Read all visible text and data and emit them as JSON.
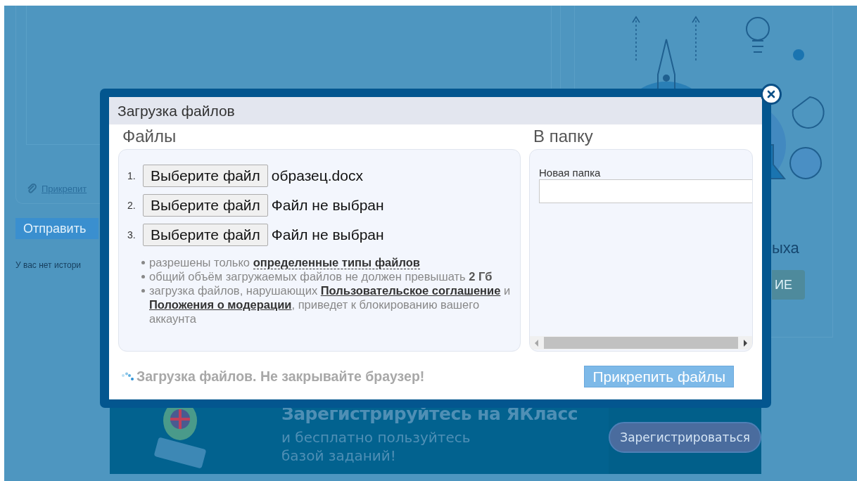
{
  "background_page": {
    "attach_link": "Прикрепит",
    "send_button": "Отправить",
    "history_note": "У вас нет истори",
    "side_text": "ыха",
    "side_button": "ИЕ",
    "banner": {
      "heading": "Зарегистрируйтесь на ЯКласс",
      "subtext": "и бесплатно пользуйтесь\nбазой заданий!",
      "button": "Зарегистрироваться"
    }
  },
  "dialog": {
    "title": "Загрузка файлов",
    "files_heading": "Файлы",
    "folder_heading": "В папку",
    "file_rows": [
      {
        "number": "1.",
        "button": "Выберите файл",
        "file_name": "образец.docx"
      },
      {
        "number": "2.",
        "button": "Выберите файл",
        "file_name": "Файл не выбран"
      },
      {
        "number": "3.",
        "button": "Выберите файл",
        "file_name": "Файл не выбран"
      }
    ],
    "notes": [
      [
        {
          "kind": "plain",
          "text": "разрешены только "
        },
        {
          "kind": "dotted_link",
          "text": "определенные типы файлов"
        }
      ],
      [
        {
          "kind": "plain",
          "text": "общий объём загружаемых файлов не должен превышать "
        },
        {
          "kind": "bold",
          "text": "2 Гб"
        }
      ],
      [
        {
          "kind": "plain",
          "text": "загрузка файлов, нарушающих "
        },
        {
          "kind": "link",
          "text": "Пользовательское соглашение"
        },
        {
          "kind": "plain",
          "text": " и "
        },
        {
          "kind": "link",
          "text": "Положения о модерации"
        },
        {
          "kind": "plain",
          "text": ", приведет к блокированию вашего аккаунта"
        }
      ]
    ],
    "new_folder_label": "Новая папка",
    "status": "Загрузка файлов. Не закрывайте браузер!",
    "attach_button": "Прикрепить файлы"
  }
}
